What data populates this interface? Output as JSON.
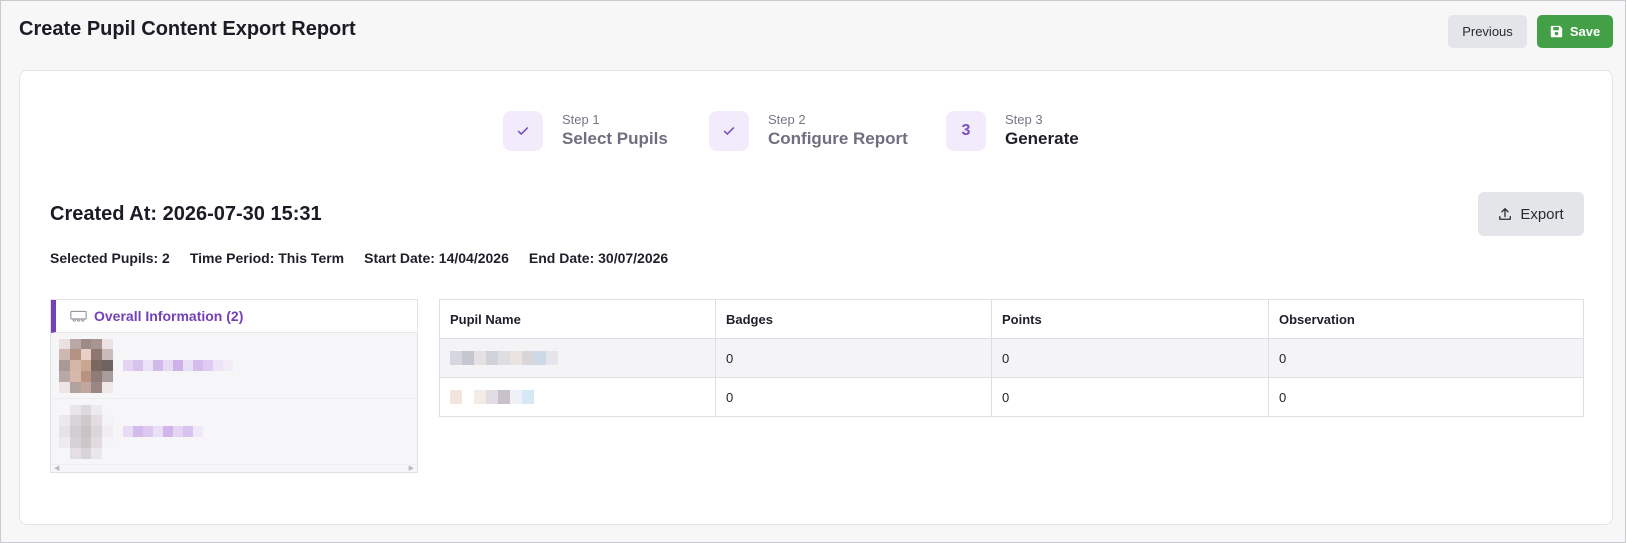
{
  "header": {
    "title": "Create Pupil Content Export Report",
    "previous_label": "Previous",
    "save_label": "Save"
  },
  "steps": [
    {
      "number": "Step 1",
      "name": "Select Pupils",
      "state": "done",
      "marker": "✓"
    },
    {
      "number": "Step 2",
      "name": "Configure Report",
      "state": "done",
      "marker": "✓"
    },
    {
      "number": "Step 3",
      "name": "Generate",
      "state": "active",
      "marker": "3"
    }
  ],
  "report": {
    "created_at": "Created At: 2026-07-30 15:31",
    "export_label": "Export",
    "selected_pupils": "Selected Pupils: 2",
    "time_period": "Time Period: This Term",
    "start_date": "Start Date: 14/04/2026",
    "end_date": "End Date: 30/07/2026"
  },
  "side_panel": {
    "title": "Overall Information (2)",
    "icon": "users-group-icon"
  },
  "table": {
    "columns": [
      "Pupil Name",
      "Badges",
      "Points",
      "Observation"
    ],
    "rows": [
      {
        "badges": "0",
        "points": "0",
        "observation": "0"
      },
      {
        "badges": "0",
        "points": "0",
        "observation": "0"
      }
    ]
  },
  "colors": {
    "accent": "#7440b8",
    "save_green": "#43a047",
    "step_bg": "#f1ebfb"
  }
}
